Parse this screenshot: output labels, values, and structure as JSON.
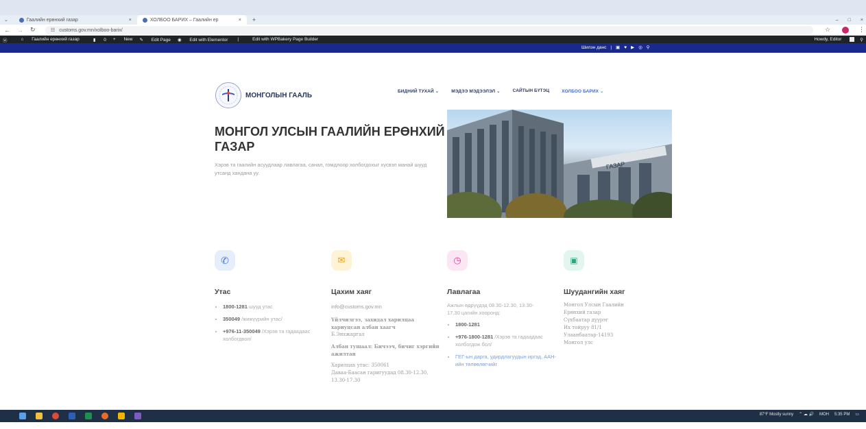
{
  "browser": {
    "tabs": [
      {
        "label": "Гаалийн ерөнхий газар",
        "active": false
      },
      {
        "label": "ХОЛБОО БАРИХ – Гаалийн ер",
        "active": true
      }
    ],
    "new_tab": "+",
    "url": "customs.gov.mn/xolboo-barix/",
    "window_controls": [
      "–",
      "□",
      "×"
    ]
  },
  "admin_bar": {
    "site": "Гаалийн ерөнхий газар",
    "comments": "0",
    "new": "New",
    "edit_page": "Edit Page",
    "elementor": "Edit with Elementor",
    "wpbakery": "Edit with WPBakery Page Builder",
    "howdy": "Howdy, Editor"
  },
  "top_strip": {
    "lang": "Шилэн данс"
  },
  "header": {
    "logo_text": "МОНГОЛЫН ГААЛЬ",
    "nav": [
      {
        "label": "БИДНИЙ ТУХАЙ",
        "active": false
      },
      {
        "label": "МЭДЭЭ МЭДЭЭЛЭЛ",
        "active": false
      },
      {
        "label": "САЙТЫН БҮТЭЦ",
        "active": false
      },
      {
        "label": "ХОЛБОО БАРИХ",
        "active": true
      }
    ]
  },
  "hero": {
    "title": "МОНГОЛ УЛСЫН ГААЛИЙН ЕРӨНХИЙ ГАЗАР",
    "subtitle": "Хэрэв та гаалийн асуудлаар лавлагаа, санал, гомдлоор холбогдохыг хүсвэл манай шууд утсанд хандана уу.",
    "building_sign": "ГАЗАР"
  },
  "contacts": {
    "phone": {
      "title": "Утас",
      "items": [
        {
          "b": "1800-1281",
          "t": " шууд утас"
        },
        {
          "b": "350049",
          "t": " /жижүүрийн утас/"
        },
        {
          "b": "+976-11-350049",
          "t": " /Хэрэв та гадаадаас холбогдвол/"
        }
      ]
    },
    "email": {
      "title": "Цахим хаяг",
      "address": "info@customs.gov.mn",
      "lines": [
        "Үйлчилгээ, захидал харилцаа хариуцсан албан хаагч",
        "Б.Энхжаргал",
        "Албан тушаал: Бичээч, бичиг хэргийн ажилтан",
        "Харилцах утас: 350061",
        "Даваа-Баасан гаригуудад 08.30-12.30, 13.30-17.30"
      ]
    },
    "info": {
      "title": "Лавлагаа",
      "intro": "Ажлын өдрүүдэд 08.30-12.30, 13.30-17.30 цагийн хооронд:",
      "items": [
        {
          "b": "1800-1281",
          "t": ""
        },
        {
          "b": "+976-1800-1281",
          "t": " /Хэрэв та гадаадаас холбогдож бол/"
        },
        {
          "b": "",
          "t": "ГЕГ-ын дарга, удирдлагуудын иргэд, ААН-ийн төлөөлөгчийг"
        }
      ]
    },
    "mail": {
      "title": "Шуудангийн хаяг",
      "lines": [
        "Монгол Улсын Гаалийн",
        "Ерөнхий газар",
        "Сүхбаатар дүүрэг",
        "Их тойруу 81/1",
        "Улаанбаатар-14193",
        "Монгол улс"
      ]
    }
  },
  "taskbar": {
    "weather": "87°F Mostly sunny",
    "lang": "МОН",
    "time": "5:35 PM"
  },
  "colors": {
    "admin_bar": "#1d2327",
    "top_strip": "#1a2a8c",
    "nav_active": "#3e6bd8",
    "phone_icon_bg": "#e6eefc",
    "email_icon_bg": "#fff3d6",
    "info_icon_bg": "#fde6f3",
    "mail_icon_bg": "#e2f6ef"
  }
}
